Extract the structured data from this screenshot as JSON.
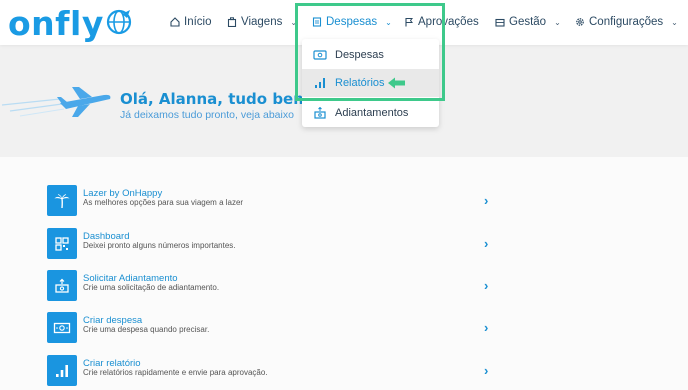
{
  "brand": {
    "logo_text": "onfly",
    "accent": "#1a9be4"
  },
  "nav": {
    "inicio": "Início",
    "viagens": "Viagens",
    "despesas": "Despesas",
    "aprovacoes": "Aprovações",
    "gestao": "Gestão",
    "configuracoes": "Configurações"
  },
  "dropdown": {
    "items": [
      {
        "label": "Despesas",
        "icon": "money-icon"
      },
      {
        "label": "Relatórios",
        "icon": "bar-chart-icon",
        "selected": true
      },
      {
        "label": "Adiantamentos",
        "icon": "advance-icon"
      }
    ],
    "highlight_color": "#3ec98b"
  },
  "banner": {
    "title": "Olá, Alanna, tudo bem?",
    "subtitle": "Já deixamos tudo pronto, veja abaixo"
  },
  "shortcuts": [
    {
      "title": "Lazer by OnHappy",
      "desc": "As melhores opções para sua viagem a lazer",
      "icon": "palm-tree-icon"
    },
    {
      "title": "Dashboard",
      "desc": "Deixei pronto alguns números importantes.",
      "icon": "dashboard-icon"
    },
    {
      "title": "Solicitar Adiantamento",
      "desc": "Crie uma solicitação de adiantamento.",
      "icon": "advance-icon"
    },
    {
      "title": "Criar despesa",
      "desc": "Crie uma despesa quando precisar.",
      "icon": "money-icon"
    },
    {
      "title": "Criar relatório",
      "desc": "Crie relatórios rapidamente e envie para aprovação.",
      "icon": "bar-chart-icon"
    }
  ]
}
